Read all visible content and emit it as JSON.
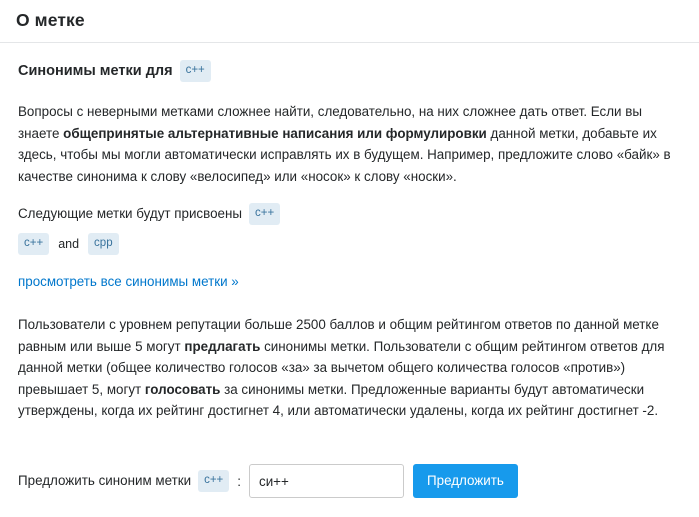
{
  "header": {
    "title": "О метке"
  },
  "section": {
    "heading_text": "Синонимы метки для",
    "heading_tag": "c++"
  },
  "paragraphs": {
    "intro_part1": "Вопросы с неверными метками сложнее найти, следовательно, на них сложнее дать ответ. Если вы знаете ",
    "intro_bold": "общепринятые альтернативные написания или формулировки",
    "intro_part2": " данной метки, добавьте их здесь, чтобы мы могли автоматически исправлять их в будущем. Например, предложите слово «байк» в качестве синонима к слову «велосипед» или «носок» к слову «носки».",
    "rep_part1": "Пользователи с уровнем репутации больше 2500 баллов и общим рейтингом ответов по данной метке равным или выше 5 могут ",
    "rep_bold1": "предлагать",
    "rep_part2": " синонимы метки. Пользователи с общим рейтингом ответов для данной метки (общее количество голосов «за» за вычетом общего количества голосов «против») превышает 5, могут ",
    "rep_bold2": "голосовать",
    "rep_part3": " за синонимы метки. Предложенные варианты будут автоматически утверждены, когда их рейтинг достигнет 4, или автоматически удалены, когда их рейтинг достигнет -2."
  },
  "assigned": {
    "label": "Следующие метки будут присвоены",
    "target_tag": "c++",
    "from_tag": "c++",
    "conjunction": "and",
    "to_tag": "cpp"
  },
  "link": {
    "view_all_synonyms": "просмотреть все синонимы метки »"
  },
  "suggest_form": {
    "label": "Предложить синоним метки",
    "tag": "c++",
    "colon": ":",
    "input_value": "си++",
    "input_placeholder": "",
    "button_label": "Предложить"
  },
  "colors": {
    "tag_background": "#e1ecf4",
    "tag_text": "#39739d",
    "link": "#0077cc",
    "button": "#179aec",
    "text": "#242729",
    "divider": "#e4e6e8"
  }
}
